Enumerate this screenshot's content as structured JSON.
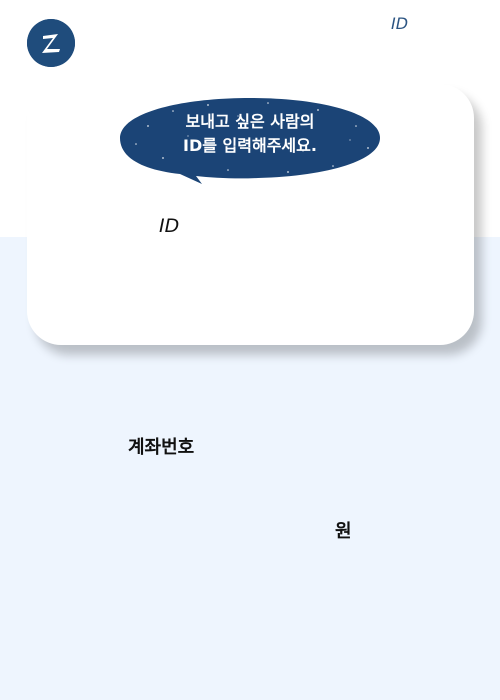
{
  "header": {
    "logo_letter": "Z",
    "top_right_label": "ID"
  },
  "card": {
    "bubble_line1": "보내고 싶은 사람의",
    "bubble_line2": "ID를 입력해주세요.",
    "id_label": "ID"
  },
  "form": {
    "account_label": "계좌번호",
    "currency_label": "원"
  },
  "colors": {
    "brand_navy": "#1f4c7c",
    "bubble_fill": "#1b4476",
    "lower_background": "#eef5fe"
  }
}
